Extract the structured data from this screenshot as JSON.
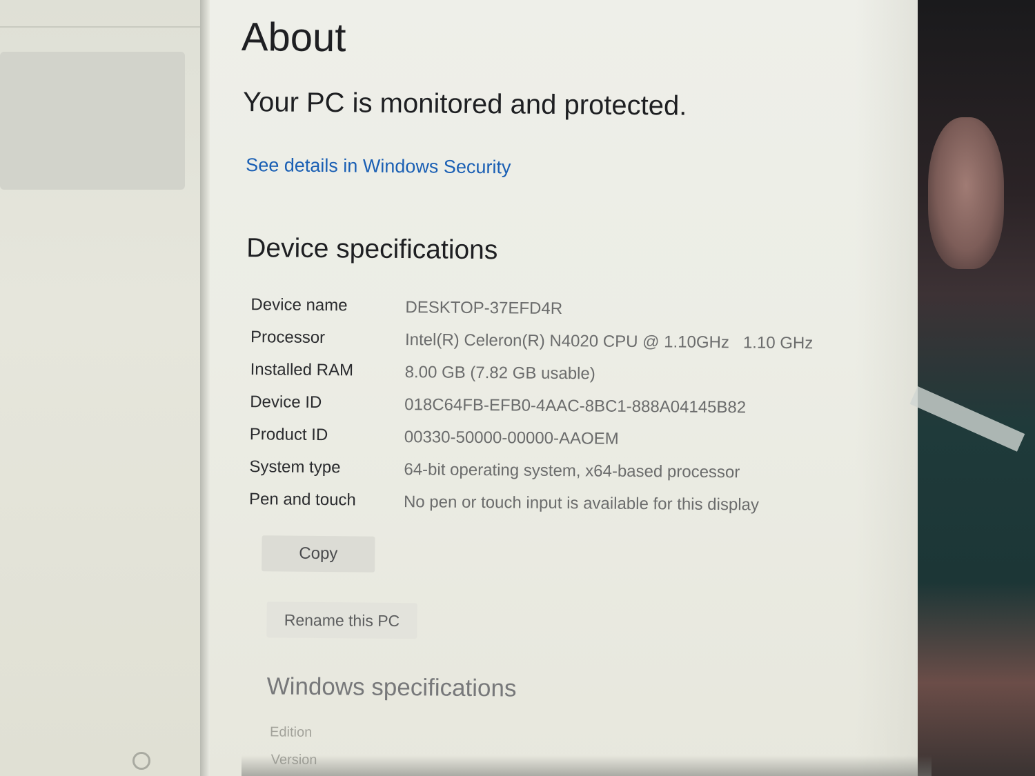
{
  "page": {
    "title": "About",
    "protection_status": "Your PC is monitored and protected.",
    "security_link": "See details in Windows Security"
  },
  "device_specs": {
    "heading": "Device specifications",
    "rows": [
      {
        "label": "Device name",
        "value": "DESKTOP-37EFD4R"
      },
      {
        "label": "Processor",
        "value": "Intel(R) Celeron(R) N4020 CPU @ 1.10GHz   1.10 GHz"
      },
      {
        "label": "Installed RAM",
        "value": "8.00 GB (7.82 GB usable)"
      },
      {
        "label": "Device ID",
        "value": "018C64FB-EFB0-4AAC-8BC1-888A04145B82"
      },
      {
        "label": "Product ID",
        "value": "00330-50000-00000-AAOEM"
      },
      {
        "label": "System type",
        "value": "64-bit operating system, x64-based processor"
      },
      {
        "label": "Pen and touch",
        "value": "No pen or touch input is available for this display"
      }
    ],
    "copy_label": "Copy",
    "rename_label": "Rename this PC"
  },
  "windows_specs": {
    "heading": "Windows specifications",
    "edition_label": "Edition",
    "version_label": "Version"
  },
  "icons": {
    "sidebar_settings": "gear-icon"
  }
}
